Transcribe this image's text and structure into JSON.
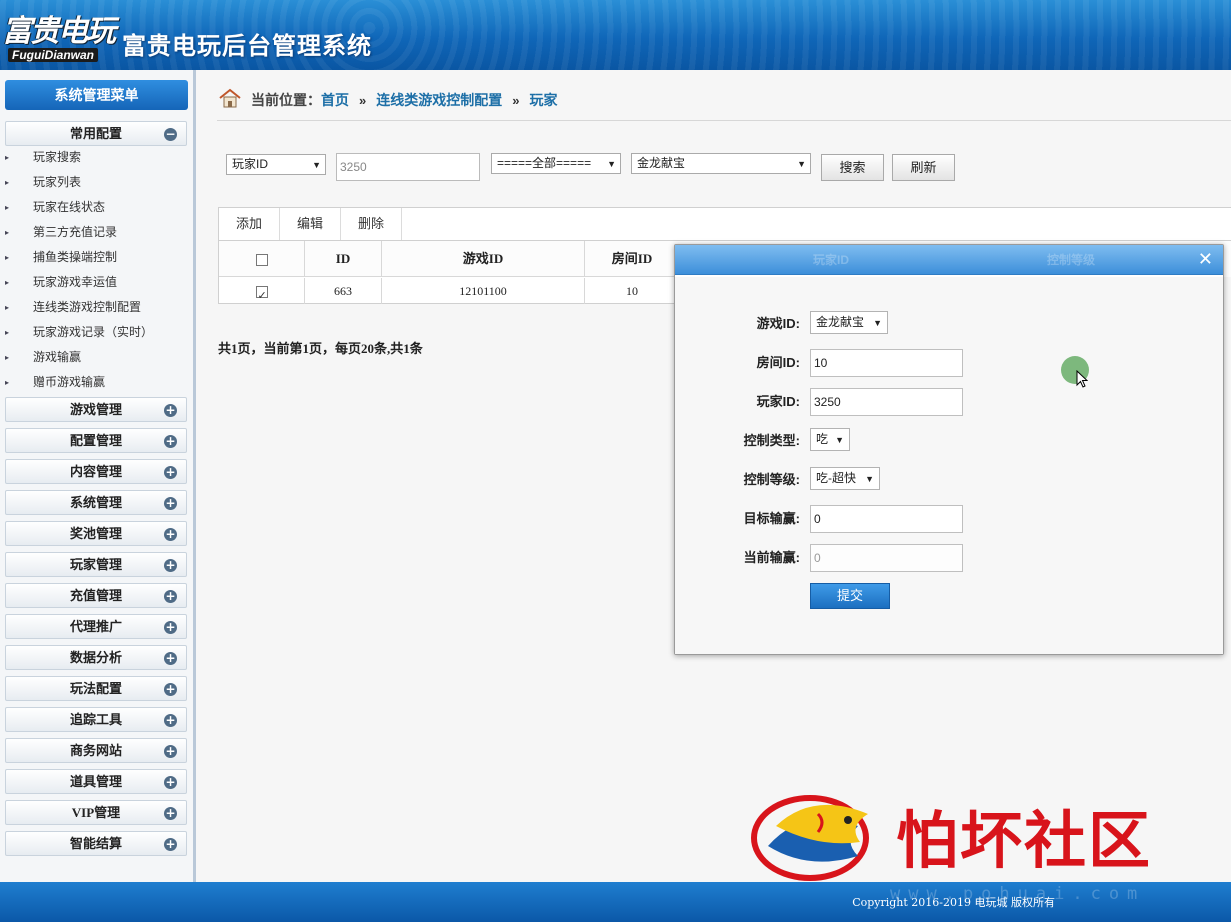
{
  "header": {
    "logo_cn": "富贵电玩",
    "logo_en": "FuguiDianwan",
    "title": "富贵电玩后台管理系统"
  },
  "sidebar": {
    "menu_title": "系统管理菜单",
    "open_group": {
      "label": "常用配置",
      "items": [
        "玩家搜索",
        "玩家列表",
        "玩家在线状态",
        "第三方充值记录",
        "捕鱼类操端控制",
        "玩家游戏幸运值",
        "连线类游戏控制配置",
        "玩家游戏记录（实时）",
        "游戏输赢",
        "赠币游戏输赢"
      ]
    },
    "groups": [
      "游戏管理",
      "配置管理",
      "内容管理",
      "系统管理",
      "奖池管理",
      "玩家管理",
      "充值管理",
      "代理推广",
      "数据分析",
      "玩法配置",
      "追踪工具",
      "商务网站",
      "道具管理",
      "VIP管理",
      "智能结算"
    ]
  },
  "breadcrumb": {
    "prefix": "当前位置：",
    "home": "首页",
    "section": "连线类游戏控制配置",
    "current": "玩家",
    "separator": "»"
  },
  "filters": {
    "field_select": "玩家ID",
    "search_value": "3250",
    "status_select": "=====全部=====",
    "game_select": "金龙献宝",
    "search_button": "搜索",
    "refresh_button": "刷新"
  },
  "toolbar": {
    "add": "添加",
    "edit": "编辑",
    "delete": "删除"
  },
  "table": {
    "headers": [
      "ID",
      "游戏ID",
      "房间ID"
    ],
    "hidden_headers": [
      "玩家ID",
      "控制等级"
    ],
    "rows": [
      {
        "checked": true,
        "id": "663",
        "game_id": "12101100",
        "room_id": "10"
      }
    ]
  },
  "pager": {
    "text": "共1页，当前第1页，每页20条,共1条"
  },
  "modal": {
    "close": "✕",
    "fields": {
      "game_label": "游戏ID:",
      "game_value": "金龙献宝",
      "room_label": "房间ID:",
      "room_value": "10",
      "player_label": "玩家ID:",
      "player_value": "3250",
      "ctrl_type_label": "控制类型:",
      "ctrl_type_value": "吃",
      "ctrl_level_label": "控制等级:",
      "ctrl_level_value": "吃-超快",
      "target_label": "目标输赢:",
      "target_value": "0",
      "current_label": "当前输赢:",
      "current_value": "0"
    },
    "submit": "提交"
  },
  "footer": {
    "copyright": "Copyright 2016-2019 电玩城 版权所有"
  },
  "watermark": {
    "text": "怕坏社区",
    "url": "www.pohuai.com"
  },
  "colors": {
    "header_blue": "#0f66b8",
    "link_blue": "#1d6fa7",
    "watermark_red": "#d8141b"
  }
}
